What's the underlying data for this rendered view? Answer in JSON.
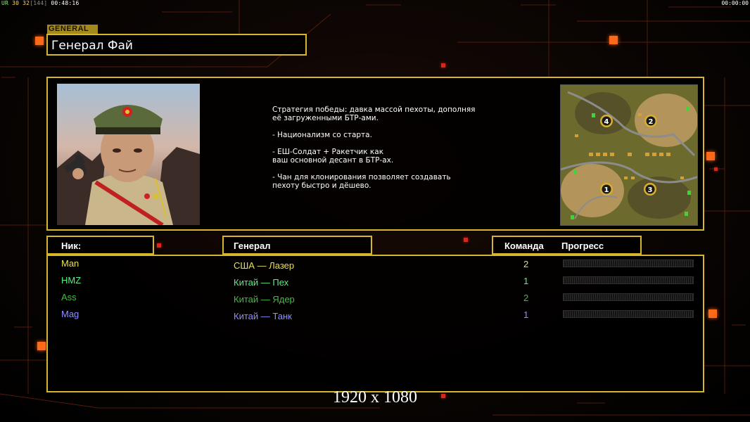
{
  "hud": {
    "left_a": "UR",
    "left_b": "30",
    "left_c": "32",
    "left_d": "[144]",
    "left_time": "00:48:16",
    "right_time": "00:00:00"
  },
  "colors": {
    "gold": "#d6b62a",
    "orange_accent": "#ff6a1a",
    "player_man": "#e8e05a",
    "player_hmz": "#5aef7e",
    "player_ass": "#3fbf3f",
    "player_mag": "#8f90ff"
  },
  "general_tag": "GENERAL",
  "general_name": "Генерал Фай",
  "description": "Стратегия победы: давка массой пехоты, дополняя\n её загруженными БТР-ами.\n\n- Национализм со старта.\n\n- ЕШ-Солдат + Ракетчик как\nваш основной десант в БТР-ах.\n\n- Чан для клонирования позволяет создавать\n пехоту быстро и дёшево.",
  "minimap": {
    "slot_labels": [
      "4",
      "2",
      "1",
      "3"
    ]
  },
  "table": {
    "headers": {
      "nick": "Ник:",
      "general": "Генерал",
      "team": "Команда",
      "progress": "Прогресс"
    },
    "rows": [
      {
        "nick": "Man",
        "general": "США — Лазер",
        "team": "2",
        "progress": 0
      },
      {
        "nick": "HMZ",
        "general": "Китай — Пех",
        "team": "1",
        "progress": 0
      },
      {
        "nick": "Ass",
        "general": "Китай — Ядер",
        "team": "2",
        "progress": 0
      },
      {
        "nick": "Mag",
        "general": "Китай — Танк",
        "team": "1",
        "progress": 0
      }
    ]
  },
  "resolution_label": "1920 x 1080"
}
